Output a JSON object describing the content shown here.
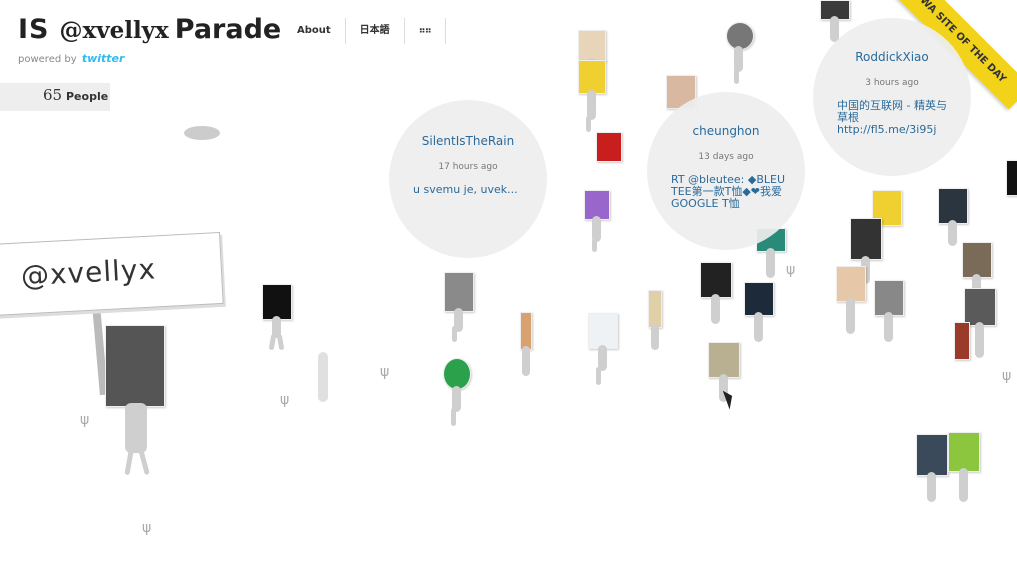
{
  "header": {
    "title_prefix": "IS",
    "title_user": "@xvellyx",
    "title_suffix": "Parade",
    "powered_by": "powered by",
    "powered_brand": "twitter"
  },
  "nav": {
    "items": [
      {
        "label": "About"
      },
      {
        "label": "日本語"
      },
      {
        "label": "⠶⠶"
      }
    ]
  },
  "people": {
    "count": "65",
    "label": "People"
  },
  "sign": {
    "text": "@xvellyx"
  },
  "ribbon": {
    "text": "FWA SITE OF THE DAY"
  },
  "bubbles": [
    {
      "user": "SilentIsTheRain",
      "time": "17 hours ago",
      "message": "u svemu je, uvek..."
    },
    {
      "user": "cheunghon",
      "time": "13 days ago",
      "message": "RT @bleutee: ◆BLEU TEE第一款T恤◆❤我爱GOOGLE T恤"
    },
    {
      "user": "RoddickXiao",
      "time": "3 hours ago",
      "message": "中国的互联网 - 精英与草根 http://fl5.me/3i95j"
    }
  ],
  "colors": {
    "link": "#2a6a9a",
    "bubble_bg": "#eeeeee",
    "ribbon": "#f3d21a",
    "twitter": "#33bbee"
  }
}
